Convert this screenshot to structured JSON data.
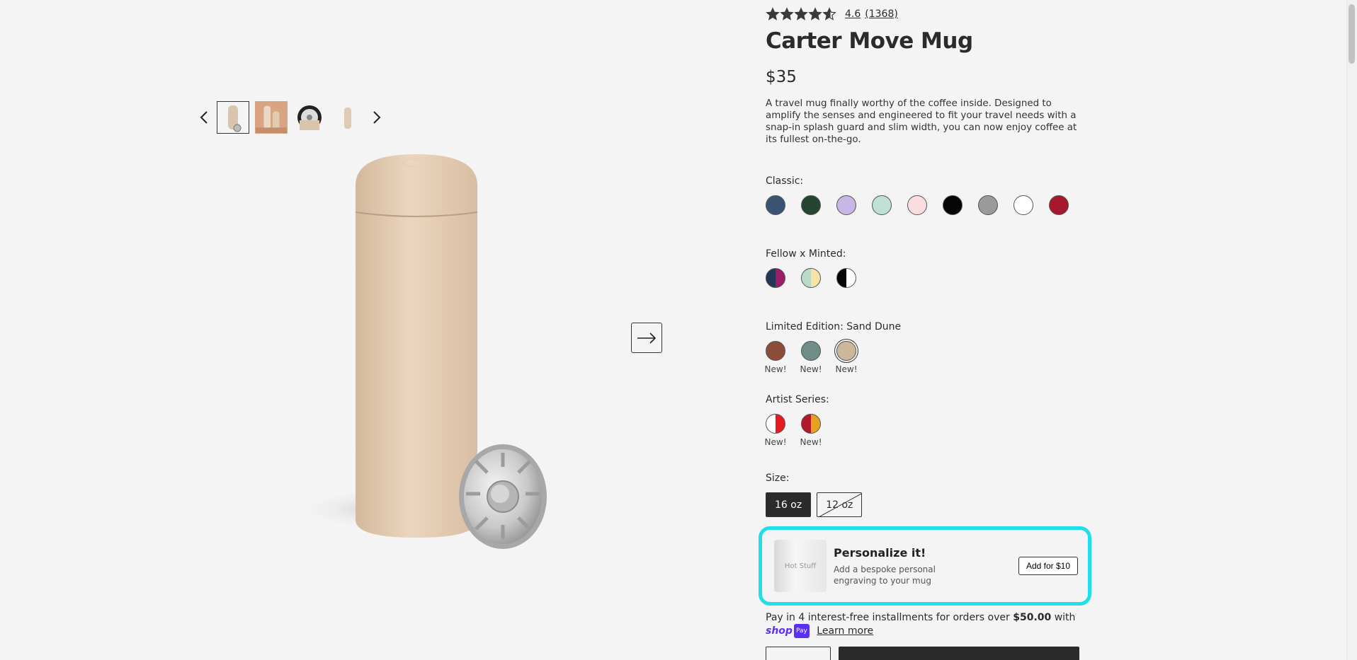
{
  "gallery": {
    "thumbnail_count": 4,
    "active_thumbnail": 0
  },
  "product": {
    "rating_value": "4.6",
    "review_count": "(1368)",
    "stars_filled": 4.6,
    "name": "Carter Move Mug",
    "price": "$35",
    "description": "A travel mug finally worthy of the coffee inside. Designed to amplify the senses and engineered to fit your travel needs with a snap-in splash guard and slim width, you can now enjoy coffee at its fullest on-the-go."
  },
  "swatches": {
    "classic": {
      "label": "Classic:",
      "colors": [
        "#3a5373",
        "#24452f",
        "#c7b6e6",
        "#bfe0d4",
        "#fbdde0",
        "#050505",
        "#9a9a9a",
        "#ffffff",
        "#a5182d"
      ]
    },
    "minted": {
      "label": "Fellow x Minted:",
      "colors": [
        [
          "#233657",
          "#9b1d6a"
        ],
        [
          "#b9d9c9",
          "#f8e3a6"
        ],
        [
          "#050505",
          "#ffffff"
        ]
      ]
    },
    "limited": {
      "label": "Limited Edition: Sand Dune",
      "colors": [
        "#8c4c3a",
        "#6f8c86",
        "#cdb79a"
      ],
      "tags": [
        "New!",
        "New!",
        "New!"
      ],
      "selected_index": 2
    },
    "artist": {
      "label": "Artist Series:",
      "colors": [
        [
          "#ffffff",
          "#e8191c"
        ],
        [
          "#b3172d",
          "#e6a21c"
        ]
      ],
      "tags": [
        "New!",
        "New!"
      ]
    }
  },
  "size": {
    "label": "Size:",
    "options": [
      "16 oz",
      "12 oz"
    ],
    "selected_index": 0,
    "unavailable_index": 1
  },
  "personalize": {
    "image_text": "Hot Stuff",
    "title": "Personalize it!",
    "subtitle": "Add a bespoke personal engraving to your mug",
    "button_label": "Add for $10",
    "highlight_color": "#1fe0ea"
  },
  "installments": {
    "text_before": "Pay in 4 interest-free installments for orders over ",
    "amount": "$50.00",
    "text_after": " with",
    "shop_word": "shop",
    "pay_badge": "Pay",
    "learn_more": "Learn more"
  },
  "colors": {
    "background": "#f4f4f4",
    "text": "#2b2b2b",
    "shop_pay": "#5a31f4"
  }
}
